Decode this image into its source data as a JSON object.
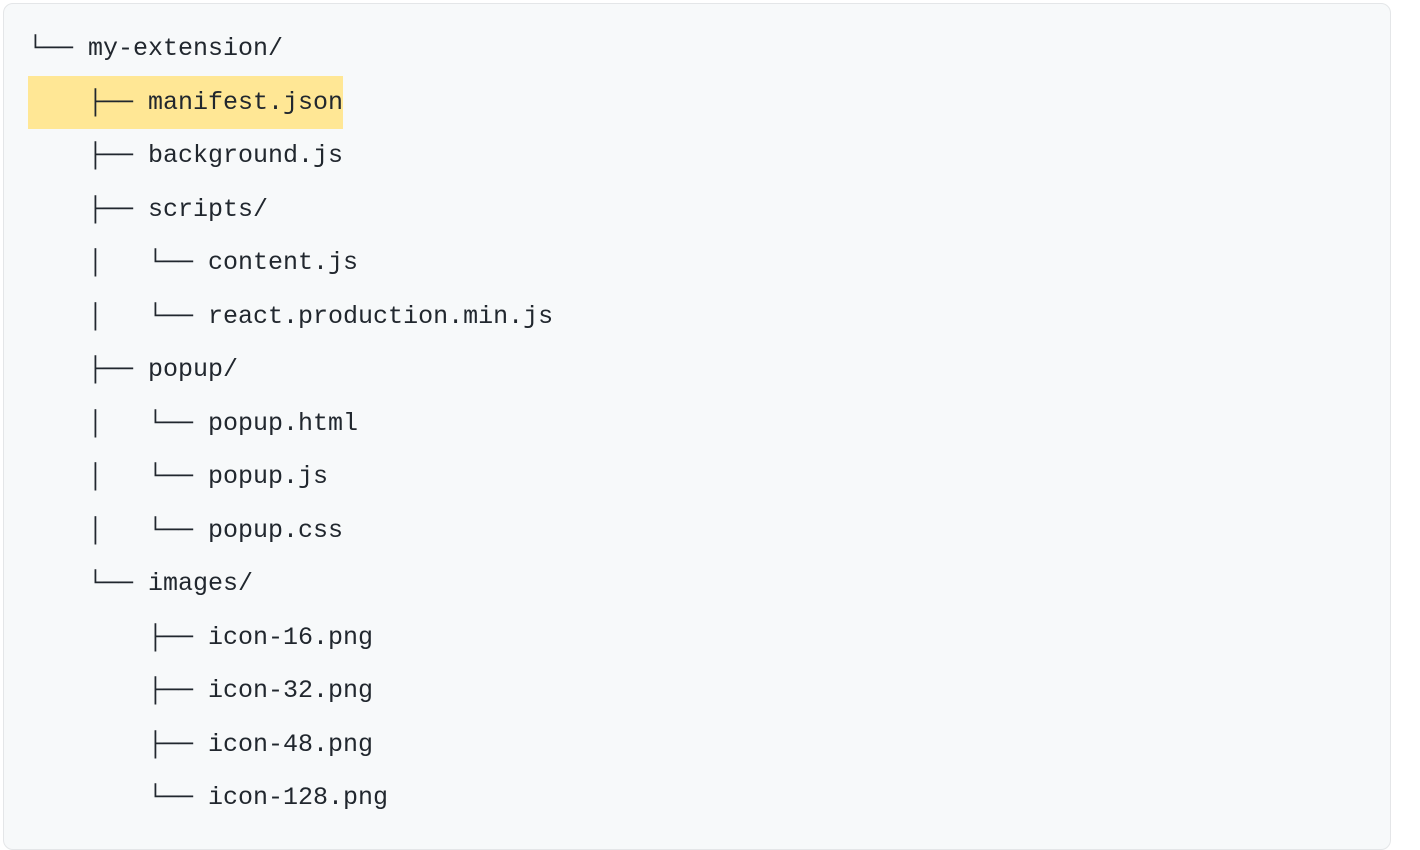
{
  "tree": {
    "lines": [
      {
        "branch": "└── ",
        "name": "my-extension/",
        "highlight": false
      },
      {
        "branch": "    ├── ",
        "name": "manifest.json",
        "highlight": true
      },
      {
        "branch": "    ├── ",
        "name": "background.js",
        "highlight": false
      },
      {
        "branch": "    ├── ",
        "name": "scripts/",
        "highlight": false
      },
      {
        "branch": "    │   └── ",
        "name": "content.js",
        "highlight": false
      },
      {
        "branch": "    │   └── ",
        "name": "react.production.min.js",
        "highlight": false
      },
      {
        "branch": "    ├── ",
        "name": "popup/",
        "highlight": false
      },
      {
        "branch": "    │   └── ",
        "name": "popup.html",
        "highlight": false
      },
      {
        "branch": "    │   └── ",
        "name": "popup.js",
        "highlight": false
      },
      {
        "branch": "    │   └── ",
        "name": "popup.css",
        "highlight": false
      },
      {
        "branch": "    └── ",
        "name": "images/",
        "highlight": false
      },
      {
        "branch": "        ├── ",
        "name": "icon-16.png",
        "highlight": false
      },
      {
        "branch": "        ├── ",
        "name": "icon-32.png",
        "highlight": false
      },
      {
        "branch": "        ├── ",
        "name": "icon-48.png",
        "highlight": false
      },
      {
        "branch": "        └── ",
        "name": "icon-128.png",
        "highlight": false
      }
    ]
  }
}
